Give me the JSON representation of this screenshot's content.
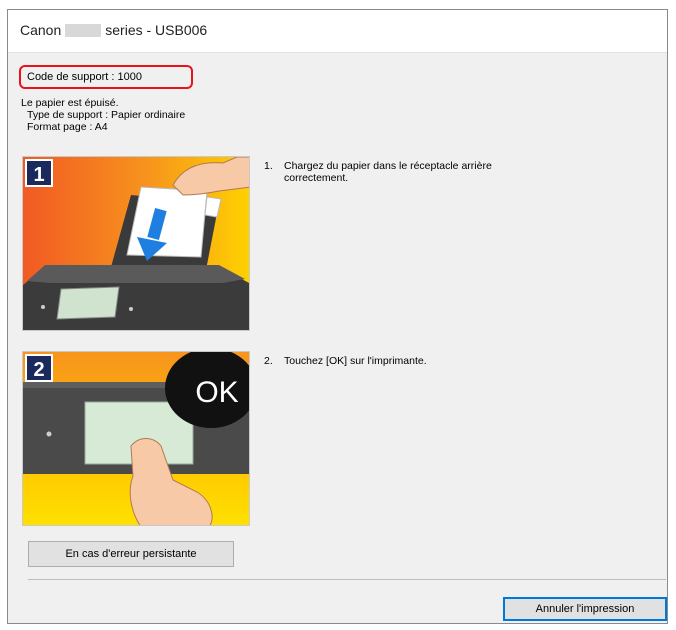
{
  "window": {
    "title_prefix": "Canon",
    "title_suffix": "series - USB006"
  },
  "error": {
    "code_label": "Code de support : 1000",
    "message": "Le papier est épuisé.",
    "media_type": "Type de support : Papier ordinaire",
    "page_format": "Format page : A4"
  },
  "steps": [
    {
      "number": "1",
      "badge": "1",
      "text_line1": "Chargez du papier dans le réceptacle arrière",
      "text_line2": "correctement."
    },
    {
      "number": "2",
      "badge": "2",
      "text_line1": "Touchez [OK] sur l'imprimante.",
      "text_line2": "",
      "bubble_text": "OK"
    }
  ],
  "buttons": {
    "persistent_error": "En cas d'erreur persistante",
    "cancel_print": "Annuler l'impression"
  },
  "colors": {
    "alert_red": "#e8131b",
    "illustration_orange": "#f7941d",
    "illustration_yellow": "#ffd200",
    "badge_navy": "#1b2a5c",
    "arrow_blue": "#1e7fe0",
    "focus_blue": "#0078d7"
  }
}
